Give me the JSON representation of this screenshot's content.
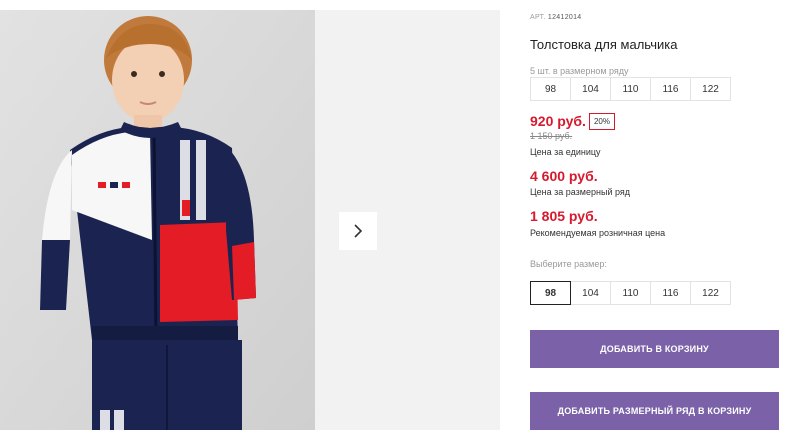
{
  "gallery": {
    "photo_alt": "",
    "next_icon": "chevron-right-icon"
  },
  "product": {
    "article_label": "АРТ.",
    "article_number": "12412014",
    "title": "Толстовка для мальчика",
    "pack_label": "5 шт. в размерном ряду",
    "pack_sizes": [
      "98",
      "104",
      "110",
      "116",
      "122"
    ],
    "price": "920 руб.",
    "discount": "20%",
    "old_price": "1 150 руб.",
    "price_unit_note": "Цена за единицу",
    "pack_price": "4 600 руб.",
    "pack_price_note": "Цена за размерный ряд",
    "retail_price": "1 805 руб.",
    "retail_price_note": "Рекомендуемая розничная цена",
    "choose_size_label": "Выберите размер:",
    "sizes": [
      "98",
      "104",
      "110",
      "116",
      "122"
    ],
    "selected_size": "98"
  },
  "buttons": {
    "add_to_cart": "ДОБАВИТЬ В КОРЗИНУ",
    "add_pack_to_cart": "ДОБАВИТЬ РАЗМЕРНЫЙ РЯД В КОРЗИНУ"
  },
  "colors": {
    "accent": "#7b62a8",
    "price_red": "#d7192e",
    "jacket_navy": "#1b2450",
    "jacket_red": "#e31c25"
  }
}
